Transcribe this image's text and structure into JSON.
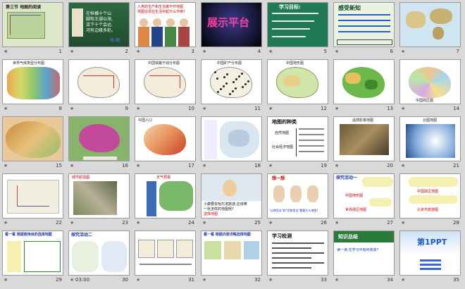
{
  "slides": [
    {
      "number": "1",
      "text": [
        "第三节  地图的阅读"
      ],
      "bg": "#dfe7c9",
      "style": "title-map"
    },
    {
      "number": "2",
      "text": [
        "在纵横十个山",
        "脚布王湖以海,",
        "流下十个会运,",
        "河有边缘多彩。",
        "地 图"
      ],
      "bg": "#2d6a3f",
      "style": "poem"
    },
    {
      "number": "3",
      "text": [
        "人类的生产和生活离不开地图",
        "地图在现在生活中起什么作用？"
      ],
      "bg": "#ffffff",
      "style": "people"
    },
    {
      "number": "4",
      "text": [
        "展示平台"
      ],
      "bg": "#111111",
      "style": "platform"
    },
    {
      "number": "5",
      "text": [
        "学习目标:"
      ],
      "bg": "#1f7a55",
      "style": "goals"
    },
    {
      "number": "6",
      "text": [
        "感受新知"
      ],
      "bg": "#eaf3e2",
      "style": "knowledge"
    },
    {
      "number": "7",
      "text": [
        ""
      ],
      "bg": "#ffffff",
      "style": "worldmap"
    },
    {
      "number": "8",
      "text": [
        "世界气候类型分布图"
      ],
      "bg": "#ffffff",
      "style": "map-color"
    },
    {
      "number": "9",
      "text": [
        ""
      ],
      "bg": "#ffffff",
      "style": "map-line"
    },
    {
      "number": "10",
      "text": [
        "中国铁路干线分布图"
      ],
      "bg": "#ffffff",
      "style": "map-line"
    },
    {
      "number": "11",
      "text": [
        "中国矿产分布图"
      ],
      "bg": "#ffffff",
      "style": "map-dots"
    },
    {
      "number": "12",
      "text": [
        "中国地形图"
      ],
      "bg": "#ffffff",
      "style": "map-green"
    },
    {
      "number": "13",
      "text": [
        ""
      ],
      "bg": "#ffffff",
      "style": "map-green2"
    },
    {
      "number": "14",
      "text": [
        "中国政区图"
      ],
      "bg": "#ffffff",
      "style": "map-political"
    },
    {
      "number": "15",
      "text": [
        ""
      ],
      "bg": "#e9c99a",
      "style": "map-relief"
    },
    {
      "number": "16",
      "text": [
        ""
      ],
      "bg": "#7cab5c",
      "style": "map-purple"
    },
    {
      "number": "17",
      "text": [
        "中国人口"
      ],
      "bg": "#ffffff",
      "style": "map-pop"
    },
    {
      "number": "18",
      "text": [
        ""
      ],
      "bg": "#ffffff",
      "style": "map-city"
    },
    {
      "number": "19",
      "text": [
        "地图的种类",
        "自然地图",
        "社会经济地图"
      ],
      "bg": "#ffffff",
      "style": "types"
    },
    {
      "number": "20",
      "text": [
        "遥感影像地图"
      ],
      "bg": "#ffffff",
      "style": "photo"
    },
    {
      "number": "21",
      "text": [
        "云图地图"
      ],
      "bg": "#ffffff",
      "style": "cloud"
    },
    {
      "number": "22",
      "text": [
        ""
      ],
      "bg": "#ffffff",
      "style": "small-map"
    },
    {
      "number": "23",
      "text": [
        "城市航拍图"
      ],
      "bg": "#ffffff",
      "style": "aerial"
    },
    {
      "number": "24",
      "text": [
        "天气预报"
      ],
      "bg": "#ffffff",
      "style": "weather"
    },
    {
      "number": "25",
      "text": [
        "小康要去哈尔滨旅游,应该带",
        "一张怎样的地图呢?",
        "选择地图"
      ],
      "bg": "#ffffff",
      "style": "question"
    },
    {
      "number": "26",
      "text": [
        "想一想",
        "\"从哪里去\"和\"到那里去\"需要什么地图?"
      ],
      "bg": "#ffffff",
      "style": "think"
    },
    {
      "number": "27",
      "text": [
        "探究活动一",
        "中国地形图",
        "世界政区地图"
      ],
      "bg": "#ffffff",
      "style": "activity"
    },
    {
      "number": "28",
      "text": [
        "中国政区地图",
        "北京市旅游图"
      ],
      "bg": "#ffffff",
      "style": "activity2"
    },
    {
      "number": "29",
      "text": [
        "看一看  根据使用目的选择地图"
      ],
      "bg": "#ffffff",
      "style": "choose"
    },
    {
      "number": "30",
      "text": [
        "探究活动二"
      ],
      "bg": "#ffffff",
      "style": "activity3",
      "time": "03:00"
    },
    {
      "number": "31",
      "text": [
        ""
      ],
      "bg": "#ffffff",
      "style": "maps-row"
    },
    {
      "number": "32",
      "text": [
        "看一看  根据内容详略选择地图"
      ],
      "bg": "#ffffff",
      "style": "maps-row2"
    },
    {
      "number": "33",
      "text": [
        "学习检测"
      ],
      "bg": "#ffffff",
      "style": "test"
    },
    {
      "number": "34",
      "text": [
        "知识总结",
        "读一读,在学习中有何收获？"
      ],
      "bg": "#ffffff",
      "style": "summary"
    },
    {
      "number": "35",
      "text": [
        "第1PPT"
      ],
      "bg": "#ffffff",
      "style": "brand"
    }
  ],
  "colors": {
    "background": "#d9d9d9",
    "green": "#2d6a3f",
    "blue": "#3b6cc7"
  },
  "icons": {
    "transition": "star-icon"
  }
}
